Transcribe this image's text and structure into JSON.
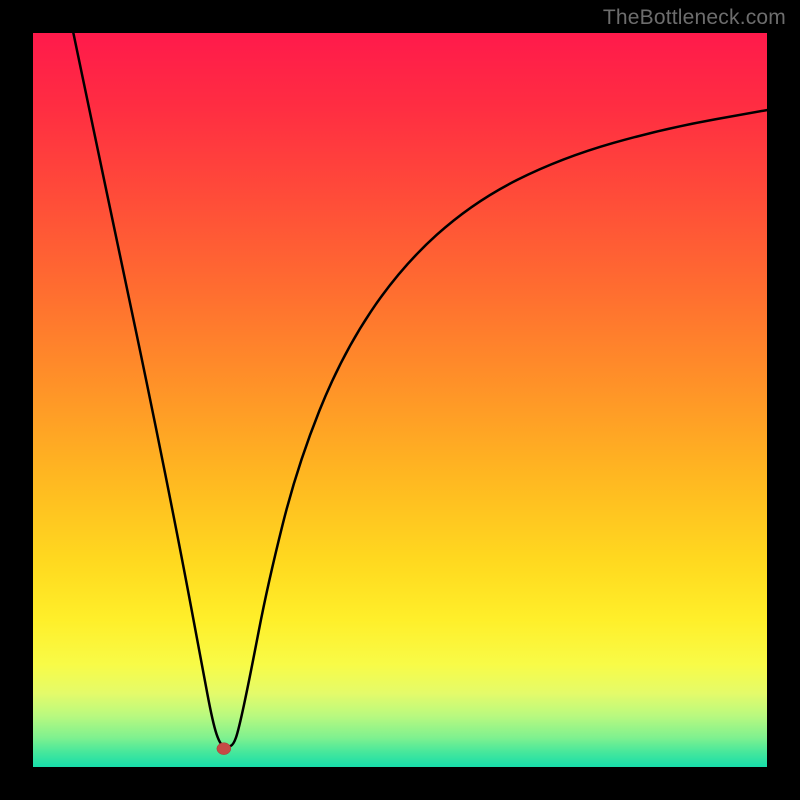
{
  "watermark": "TheBottleneck.com",
  "gradient_stops": [
    {
      "offset": "0%",
      "color": "#ff1a4b"
    },
    {
      "offset": "10%",
      "color": "#ff2d42"
    },
    {
      "offset": "22%",
      "color": "#ff4b39"
    },
    {
      "offset": "35%",
      "color": "#ff6d30"
    },
    {
      "offset": "48%",
      "color": "#ff9228"
    },
    {
      "offset": "60%",
      "color": "#ffb621"
    },
    {
      "offset": "72%",
      "color": "#ffd91f"
    },
    {
      "offset": "80%",
      "color": "#ffef2a"
    },
    {
      "offset": "86%",
      "color": "#f8fb47"
    },
    {
      "offset": "90%",
      "color": "#e4fb6a"
    },
    {
      "offset": "93%",
      "color": "#b9f97f"
    },
    {
      "offset": "96%",
      "color": "#7ff18f"
    },
    {
      "offset": "98%",
      "color": "#46e79c"
    },
    {
      "offset": "100%",
      "color": "#17deaa"
    }
  ],
  "marker": {
    "x_pct": 26.0,
    "y_pct": 97.5,
    "r": 7
  },
  "chart_data": {
    "type": "line",
    "title": "",
    "xlabel": "",
    "ylabel": "",
    "xlim": [
      0,
      100
    ],
    "ylim": [
      0,
      100
    ],
    "series": [
      {
        "name": "bottleneck-curve",
        "points": [
          {
            "x": 5.5,
            "y": 100.0
          },
          {
            "x": 8.0,
            "y": 88.0
          },
          {
            "x": 12.0,
            "y": 69.0
          },
          {
            "x": 16.0,
            "y": 50.0
          },
          {
            "x": 20.0,
            "y": 30.0
          },
          {
            "x": 23.0,
            "y": 14.0
          },
          {
            "x": 24.5,
            "y": 6.0
          },
          {
            "x": 25.5,
            "y": 3.0
          },
          {
            "x": 26.5,
            "y": 2.7
          },
          {
            "x": 27.3,
            "y": 3.0
          },
          {
            "x": 28.0,
            "y": 5.0
          },
          {
            "x": 29.5,
            "y": 12.0
          },
          {
            "x": 32.0,
            "y": 25.0
          },
          {
            "x": 36.0,
            "y": 41.0
          },
          {
            "x": 42.0,
            "y": 56.0
          },
          {
            "x": 50.0,
            "y": 68.0
          },
          {
            "x": 60.0,
            "y": 77.0
          },
          {
            "x": 72.0,
            "y": 83.0
          },
          {
            "x": 86.0,
            "y": 87.0
          },
          {
            "x": 100.0,
            "y": 89.5
          }
        ]
      }
    ],
    "annotations": [
      {
        "type": "marker",
        "x": 26.0,
        "y": 2.5,
        "color": "#c54b46"
      }
    ]
  }
}
